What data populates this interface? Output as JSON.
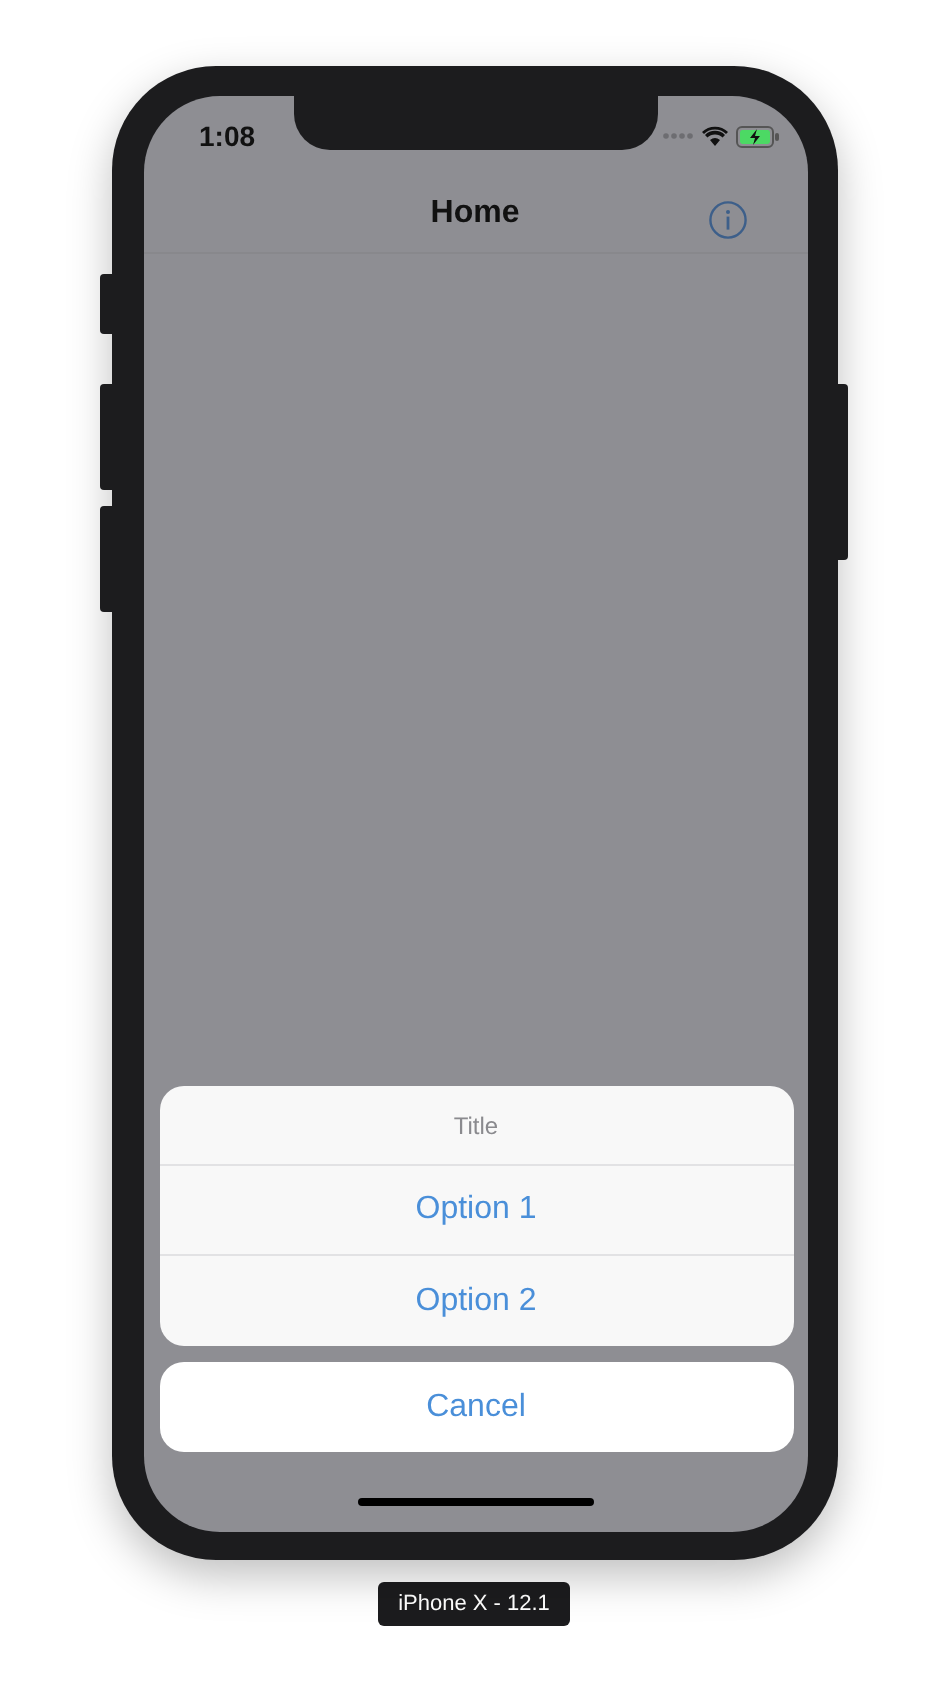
{
  "status_bar": {
    "time": "1:08"
  },
  "nav_bar": {
    "title": "Home"
  },
  "action_sheet": {
    "title": "Title",
    "options": [
      "Option 1",
      "Option 2"
    ],
    "cancel": "Cancel"
  },
  "device_label": "iPhone X - 12.1"
}
